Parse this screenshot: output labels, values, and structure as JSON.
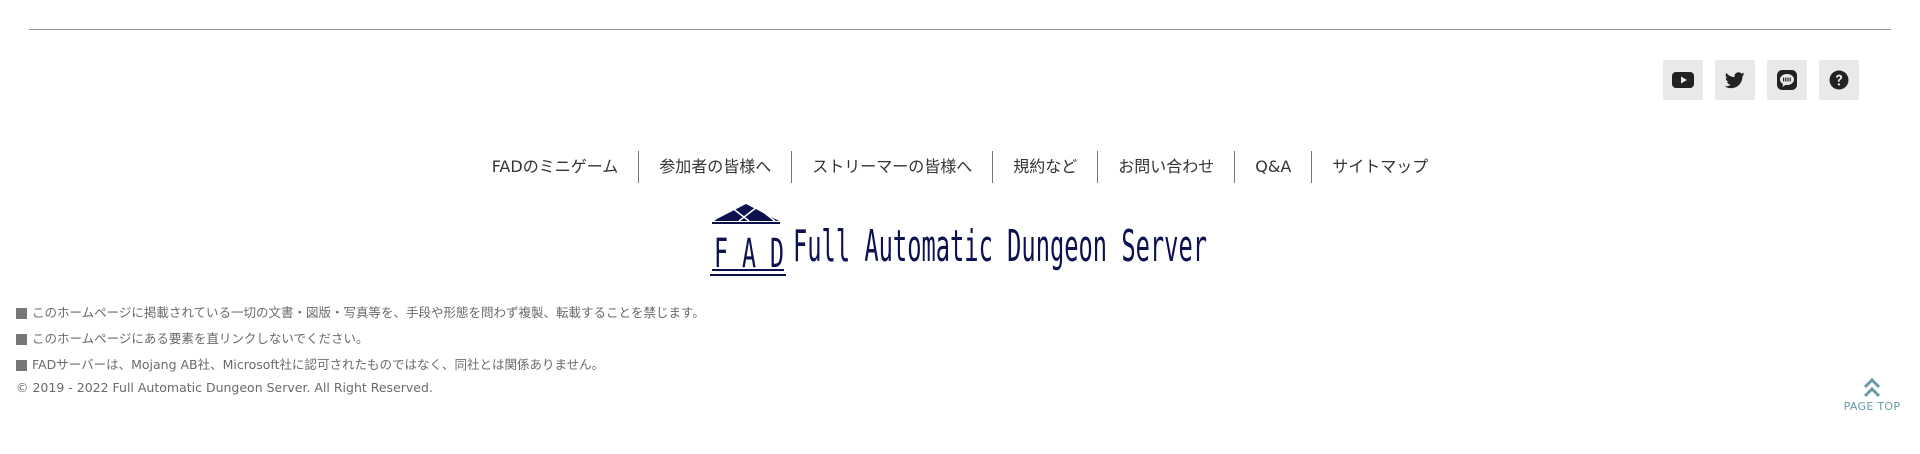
{
  "social": [
    {
      "name": "youtube-icon",
      "label": "YouTube"
    },
    {
      "name": "twitter-icon",
      "label": "Twitter"
    },
    {
      "name": "line-icon",
      "label": "LINE"
    },
    {
      "name": "help-icon",
      "label": "Help"
    }
  ],
  "nav": {
    "items": [
      {
        "label": "FADのミニゲーム"
      },
      {
        "label": "参加者の皆様へ"
      },
      {
        "label": "ストリーマーの皆様へ"
      },
      {
        "label": "規約など"
      },
      {
        "label": "お問い合わせ"
      },
      {
        "label": "Q&A"
      },
      {
        "label": "サイトマップ"
      }
    ]
  },
  "logo": {
    "mark_text": "F A D",
    "wordmark": "Full Automatic Dungeon Server",
    "color": "#0d1150"
  },
  "notes": [
    "このホームページに掲載されている一切の文書・図版・写真等を、手段や形態を問わず複製、転載することを禁じます。",
    "このホームページにある要素を直リンクしないでください。",
    "FADサーバーは、Mojang AB社、Microsoft社に認可されたものではなく、同社とは関係ありません。"
  ],
  "copyright": "© 2019 - 2022 Full Automatic Dungeon Server. All Right Reserved.",
  "pagetop": {
    "label": "PAGE TOP",
    "icon": "double-chevron-up-icon",
    "color": "#6a9aa6"
  }
}
